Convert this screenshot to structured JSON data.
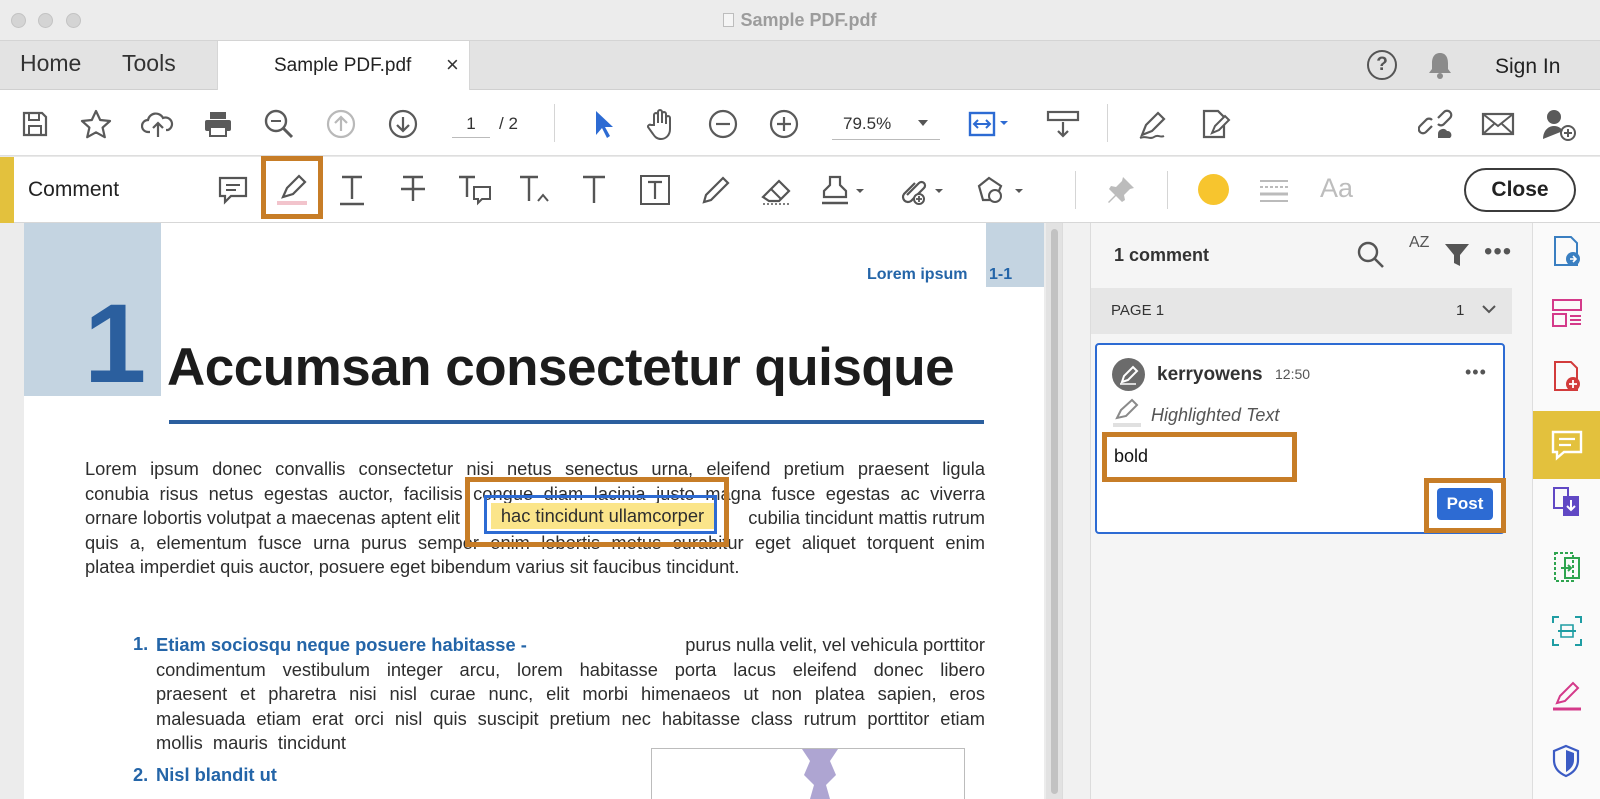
{
  "window": {
    "title": "Sample PDF.pdf"
  },
  "tabs": {
    "home": "Home",
    "tools": "Tools",
    "document": "Sample PDF.pdf",
    "close_glyph": "×",
    "sign_in": "Sign In"
  },
  "toolbar": {
    "page_current": "1",
    "page_total": "/ 2",
    "zoom": "79.5%"
  },
  "comment_bar": {
    "label": "Comment",
    "font_label": "Aa",
    "close_button": "Close",
    "highlight_color": "#f7c52e",
    "selected_tool_outline": "#c77d27"
  },
  "document": {
    "header_label": "Lorem ipsum",
    "header_page": "1-1",
    "chapter_number": "1",
    "chapter_title": "Accumsan consectetur quisque",
    "highlighted_text": "hac tincidunt ullamcorper",
    "paragraph_lines": [
      "Lorem ipsum donec convallis consectetur nisi netus senectus urna, eleifend pretium praesent ligula",
      "conubia risus netus egestas auctor, facilisis congue diam lacinia justo magna fusce egestas ac viverra",
      "ornare lobortis volutpat a maecenas aptent elit",
      "cubilia tincidunt mattis rutrum",
      "quis a, elementum fusce urna purus semper enim lobortis metus curabitur eget aliquet torquent enim",
      "platea imperdiet quis auctor, posuere eget bibendum varius sit faucibus tincidunt."
    ],
    "list": [
      {
        "number": "1.",
        "heading": "Etiam sociosqu neque posuere habitasse -",
        "first_line_rest": "purus nulla velit, vel vehicula porttitor",
        "lines": [
          "condimentum vestibulum integer arcu, lorem habitasse porta lacus eleifend donec libero",
          "praesent et pharetra nisi nisl curae nunc, elit morbi himenaeos ut non platea sapien, eros",
          "malesuada etiam erat orci nisl quis suscipit pretium nec habitasse class rutrum porttitor etiam",
          "mollis  mauris  tincidunt"
        ]
      },
      {
        "number": "2.",
        "heading": "Nisl blandit ut"
      }
    ]
  },
  "comments_panel": {
    "count_label": "1 comment",
    "sort_label": "AZ",
    "page_group": {
      "label": "PAGE 1",
      "count": "1"
    },
    "comment": {
      "author": "kerryowens",
      "time": "12:50",
      "type": "Highlighted Text",
      "input_value": "bold",
      "post_button": "Post"
    }
  }
}
